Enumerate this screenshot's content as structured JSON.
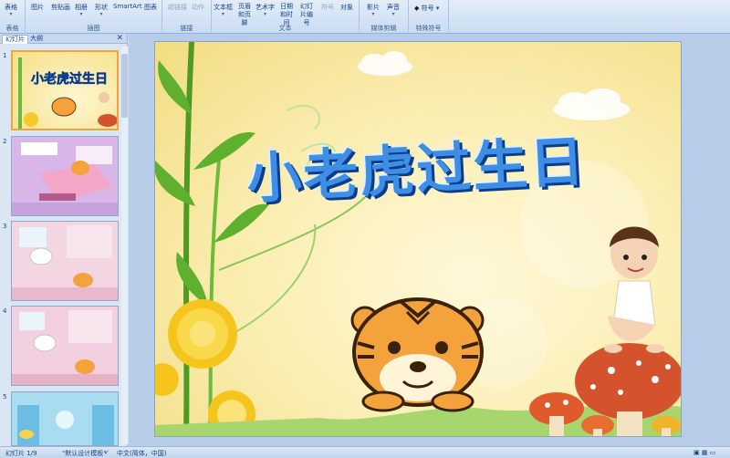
{
  "ribbon": {
    "groups": [
      {
        "label": "表格",
        "buttons": [
          "表格"
        ]
      },
      {
        "label": "插图",
        "buttons": [
          "图片",
          "剪贴画",
          "相册",
          "形状",
          "SmartArt",
          "图表"
        ]
      },
      {
        "label": "链接",
        "buttons": [
          "超链接",
          "动作"
        ]
      },
      {
        "label": "文本",
        "buttons": [
          "文本框",
          "页眉和页脚",
          "艺术字",
          "日期和时间",
          "幻灯片编号",
          "符号",
          "对象"
        ]
      },
      {
        "label": "媒体剪辑",
        "buttons": [
          "影片",
          "声音"
        ]
      },
      {
        "label": "特殊符号",
        "buttons": [
          "符号"
        ]
      }
    ]
  },
  "panel": {
    "tabs": [
      "幻灯片",
      "大纲"
    ],
    "close": "✕",
    "slide_numbers": [
      "1",
      "2",
      "3",
      "4",
      "5"
    ]
  },
  "slide": {
    "title": "小老虎过生日"
  },
  "status": {
    "slide_info": "幻灯片 1/9",
    "theme": "\"默认设计模板\"",
    "language": "中文(简体，中国)"
  }
}
